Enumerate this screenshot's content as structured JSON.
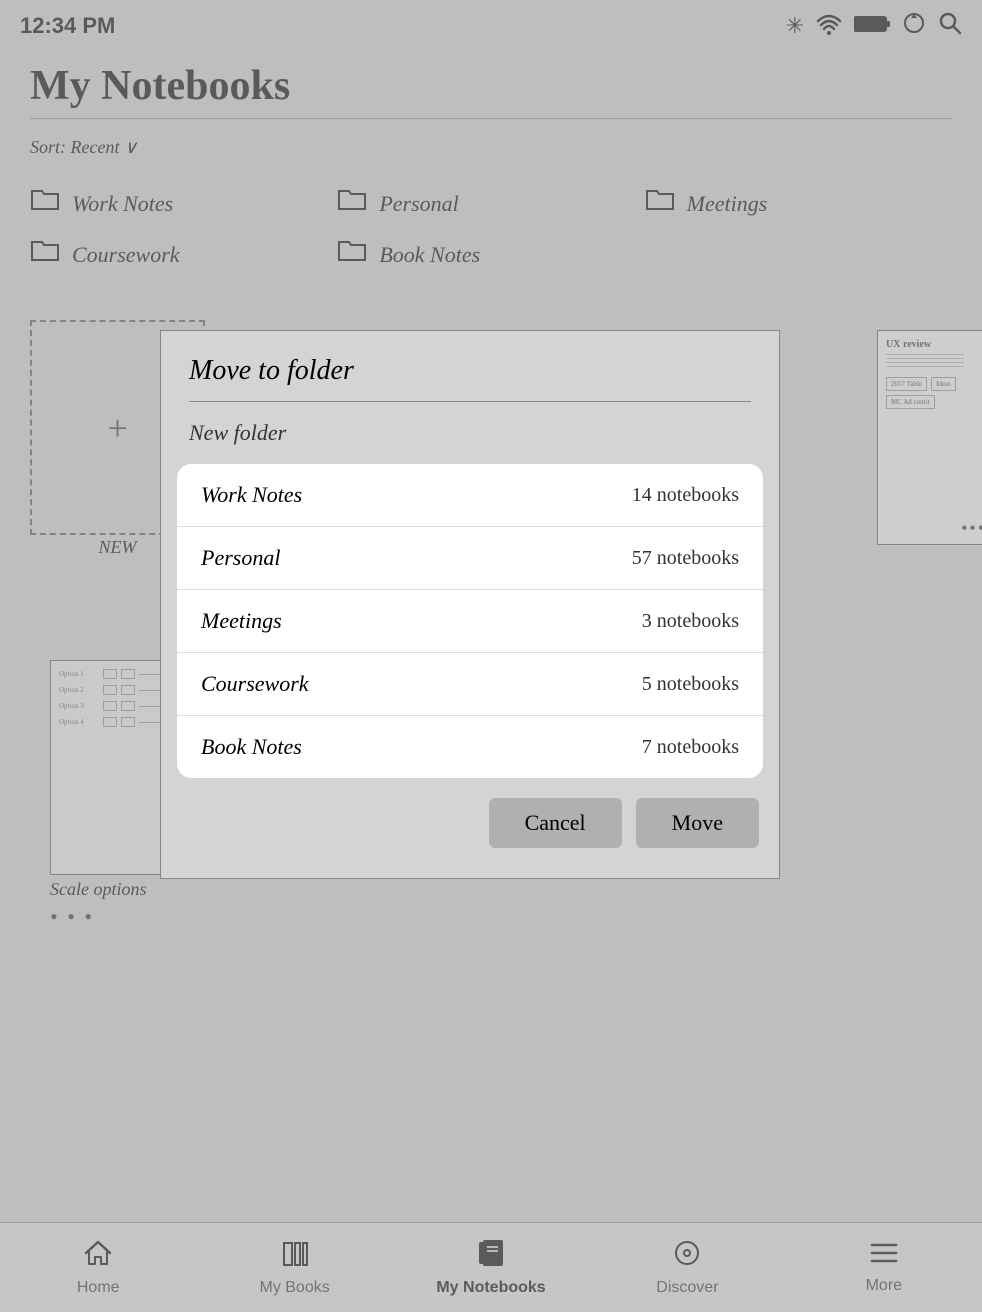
{
  "statusBar": {
    "time": "12:34 PM"
  },
  "header": {
    "title": "My Notebooks"
  },
  "sortBar": {
    "label": "Sort: Recent",
    "chevron": "∨"
  },
  "folders": [
    {
      "name": "Work Notes"
    },
    {
      "name": "Personal"
    },
    {
      "name": "Meetings"
    },
    {
      "name": "Coursework"
    },
    {
      "name": "Book Notes"
    }
  ],
  "newCard": {
    "label": "NEW"
  },
  "scaleCard": {
    "label": "Scale options"
  },
  "modal": {
    "title": "Move to folder",
    "newFolderLabel": "New folder",
    "folders": [
      {
        "name": "Work Notes",
        "count": "14 notebooks"
      },
      {
        "name": "Personal",
        "count": "57 notebooks"
      },
      {
        "name": "Meetings",
        "count": "3 notebooks"
      },
      {
        "name": "Coursework",
        "count": "5 notebooks"
      },
      {
        "name": "Book Notes",
        "count": "7 notebooks"
      }
    ],
    "cancelLabel": "Cancel",
    "moveLabel": "Move"
  },
  "bottomNav": {
    "items": [
      {
        "label": "Home",
        "icon": "⌂"
      },
      {
        "label": "My Books",
        "icon": "📊"
      },
      {
        "label": "My Notebooks",
        "icon": "📓",
        "active": true
      },
      {
        "label": "Discover",
        "icon": "⊙"
      },
      {
        "label": "More",
        "icon": "≡"
      }
    ]
  },
  "icons": {
    "brightness": "☀",
    "wifi": "WiFi",
    "battery": "▬",
    "refresh": "↻",
    "search": "🔍"
  }
}
